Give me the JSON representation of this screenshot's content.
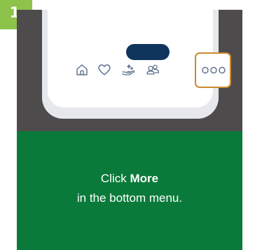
{
  "step": {
    "number": "1"
  },
  "phone": {
    "nav_icons": [
      "home-icon",
      "heart-icon",
      "giving-hand-icon",
      "people-icon"
    ],
    "more_icon": "more-dots-icon",
    "colors": {
      "frame_background": "#4e4b4c",
      "pill": "#10355c",
      "highlight": "#ca8a2e",
      "icon": "#5a6f8c"
    }
  },
  "instruction": {
    "prefix": "Click ",
    "emphasis": "More",
    "line2": "in the bottom menu.",
    "background": "#0a7a3a"
  }
}
